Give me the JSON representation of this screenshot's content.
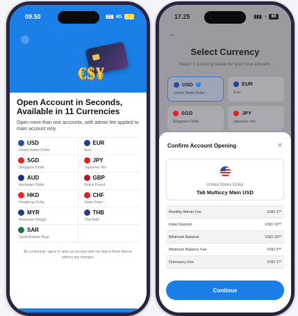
{
  "left": {
    "status": {
      "time": "09.50",
      "network": "4G",
      "battery": ""
    },
    "hero": {
      "money_text": "€$¥"
    },
    "headline": "Open Account in Seconds, Available in 11 Currencies",
    "subtext": "Open more than one accounts, with admin fee applied to main account only.",
    "currencies": [
      {
        "code": "USD",
        "name": "United States Dollar",
        "color": "#2a4da8"
      },
      {
        "code": "EUR",
        "name": "Euro",
        "color": "#1f3f9a"
      },
      {
        "code": "SGD",
        "name": "Singapore Dollar",
        "color": "#e0242b"
      },
      {
        "code": "JPY",
        "name": "Japanese Yen",
        "color": "#d8232a"
      },
      {
        "code": "AUD",
        "name": "Australian Dollar",
        "color": "#1c2f78"
      },
      {
        "code": "GBP",
        "name": "British Pound",
        "color": "#b3172d"
      },
      {
        "code": "HKD",
        "name": "Hongkong Dollar",
        "color": "#de2a2a"
      },
      {
        "code": "CHF",
        "name": "Swiss Franc",
        "color": "#d8222a"
      },
      {
        "code": "MYR",
        "name": "Malaysian Ringgit",
        "color": "#1c3d8c"
      },
      {
        "code": "THB",
        "name": "Thai Baht",
        "color": "#2a3c8c"
      },
      {
        "code": "SAR",
        "name": "Saudi Arabian Riyal",
        "color": "#1b7a3a"
      }
    ],
    "terms": "By continuing I agree to open an account with my data in Bank Mancin without any changes."
  },
  "right": {
    "status": {
      "time": "17.25",
      "battery": "89"
    },
    "title": "Select Currency",
    "subtitle": "Select 1 currency below for your new account.",
    "options": [
      {
        "code": "USD",
        "name": "United States Dollar",
        "color": "#2a4da8",
        "selected": true
      },
      {
        "code": "EUR",
        "name": "Euro",
        "color": "#1f3f9a",
        "selected": false
      },
      {
        "code": "SGD",
        "name": "Singapore Dollar",
        "color": "#e0242b",
        "selected": false
      },
      {
        "code": "JPY",
        "name": "Japanese Yen",
        "color": "#d8232a",
        "selected": false
      }
    ],
    "modal": {
      "title": "Confirm Account Opening",
      "currency_name": "United States Dollar",
      "account_name": "Tab Multiccy Main USD",
      "fees": [
        {
          "label": "Monthly Admin Fee",
          "value": "USD 1⁰⁰"
        },
        {
          "label": "Initial Deposit",
          "value": "USD 10⁰⁰"
        },
        {
          "label": "Minimum Balance",
          "value": "USD 10⁰⁰"
        },
        {
          "label": "Minimum Balance Fee",
          "value": "USD 0⁰⁰"
        },
        {
          "label": "Dormancy Fee",
          "value": "USD 1⁰⁰"
        }
      ],
      "continue_label": "Continue"
    }
  }
}
